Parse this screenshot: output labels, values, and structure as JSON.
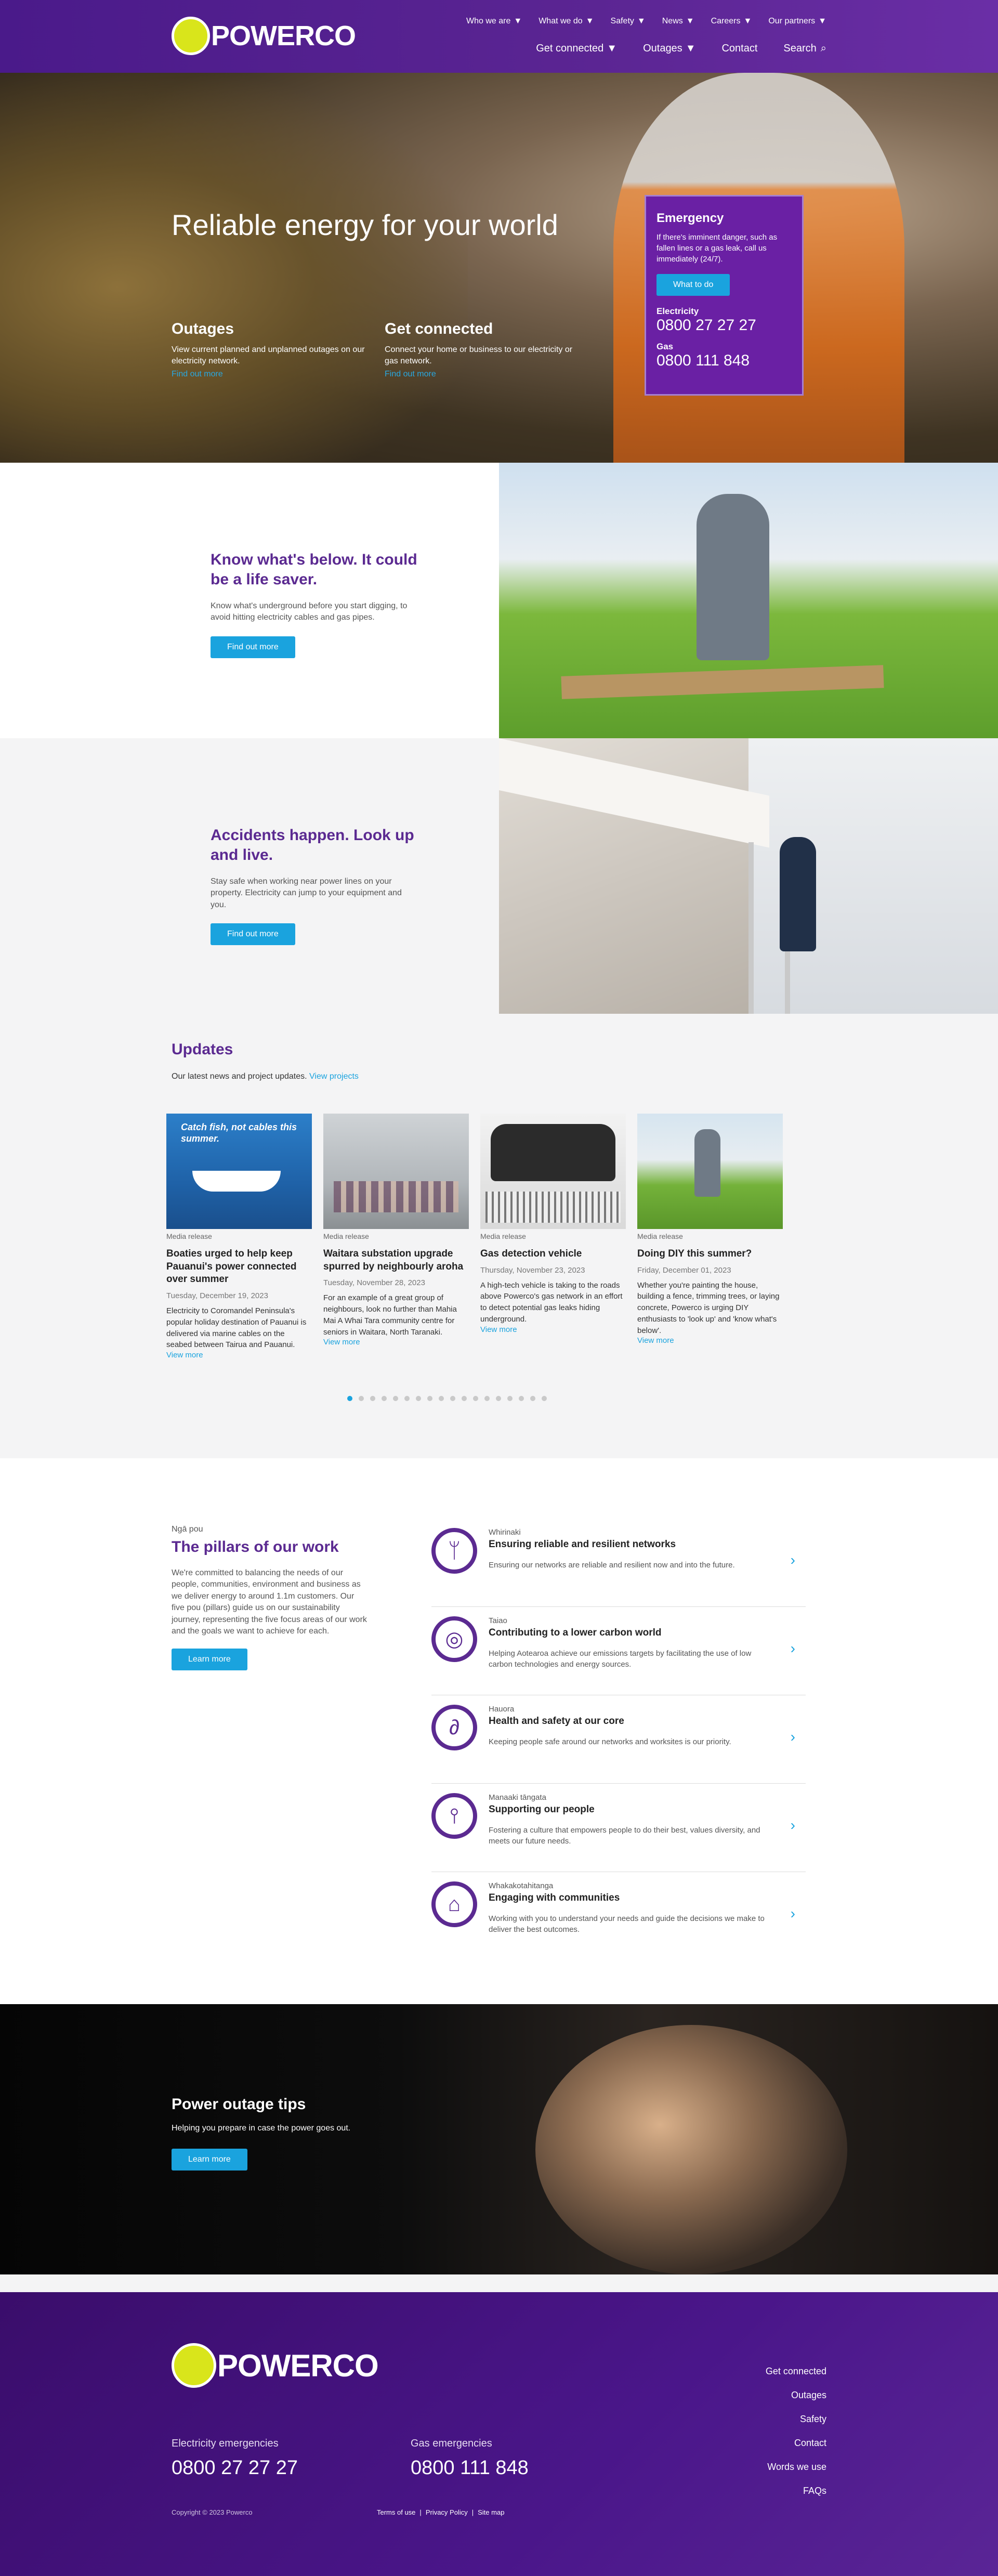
{
  "brand": {
    "name": "POWERCO"
  },
  "nav": {
    "top": [
      "Who we are",
      "What we do",
      "Safety",
      "News",
      "Careers",
      "Our partners"
    ],
    "main": [
      {
        "label": "Get connected",
        "has_menu": true
      },
      {
        "label": "Outages",
        "has_menu": true
      },
      {
        "label": "Contact",
        "has_menu": false
      },
      {
        "label": "Search",
        "has_menu": false
      }
    ]
  },
  "hero": {
    "title": "Reliable energy for your world",
    "outages": {
      "title": "Outages",
      "text": "View current planned and unplanned outages on our electricity network.",
      "link": "Find out more"
    },
    "connected": {
      "title": "Get connected",
      "text": "Connect your home or business to our electricity or gas network.",
      "link": "Find out more"
    },
    "emergency": {
      "title": "Emergency",
      "text": "If there's imminent danger, such as fallen lines or a gas leak, call us immediately (24/7).",
      "button": "What to do",
      "electricity_label": "Electricity",
      "electricity_number": "0800 27 27 27",
      "gas_label": "Gas",
      "gas_number": "0800 111 848"
    }
  },
  "features": [
    {
      "title": "Know what's below. It could be a life saver.",
      "text": "Know what's underground before you start digging, to avoid hitting electricity cables and gas pipes.",
      "button": "Find out more"
    },
    {
      "title": "Accidents happen. Look up and live.",
      "text": "Stay safe when working near power lines on your property. Electricity can jump to your equipment and you.",
      "button": "Find out more"
    }
  ],
  "updates": {
    "title": "Updates",
    "intro": "Our latest news and project updates.",
    "intro_link": "View projects",
    "cards": [
      {
        "category": "Media release",
        "thumb_text": "Catch fish, not cables this summer.",
        "title": "Boaties urged to help keep Pauanui's power connected over summer",
        "date": "Tuesday, December 19, 2023",
        "excerpt": "Electricity to Coromandel Peninsula's popular holiday destination of Pauanui is delivered via marine cables on the seabed between Tairua and Pauanui.",
        "more": "View more"
      },
      {
        "category": "Media release",
        "title": "Waitara substation upgrade spurred by neighbourly aroha",
        "date": "Tuesday, November 28, 2023",
        "excerpt": "For an example of a great group of neighbours, look no further than Mahia Mai A Whai Tara community centre for seniors in Waitara, North Taranaki.",
        "more": "View more"
      },
      {
        "category": "Media release",
        "title": "Gas detection vehicle",
        "date": "Thursday, November 23, 2023",
        "excerpt": "A high-tech vehicle is taking to the roads above Powerco's gas network in an effort to detect potential gas leaks hiding underground.",
        "more": "View more"
      },
      {
        "category": "Media release",
        "title": "Doing DIY this summer?",
        "date": "Friday, December 01, 2023",
        "excerpt": "Whether you're painting the house, building a fence, trimming trees, or laying concrete, Powerco is urging DIY enthusiasts to 'look up' and 'know what's below'.",
        "more": "View more"
      }
    ],
    "dot_count": 18,
    "active_dot": 1
  },
  "pillars": {
    "eyebrow": "Ngā pou",
    "title": "The pillars of our work",
    "description": "We're committed to balancing the needs of our people, communities, environment and business as we deliver energy to around 1.1m customers. Our five pou (pillars) guide us on our sustainability journey, representing the five focus areas of our work and the goals we want to achieve for each.",
    "button": "Learn more",
    "items": [
      {
        "sub": "Whirinaki",
        "title": "Ensuring reliable and resilient networks",
        "text": "Ensuring our networks are reliable and resilient now and into the future.",
        "icon": "network-pillar-icon"
      },
      {
        "sub": "Taiao",
        "title": "Contributing to a lower carbon world",
        "text": "Helping Aotearoa achieve our emissions targets by facilitating the use of low carbon technologies and energy sources.",
        "icon": "carbon-pillar-icon"
      },
      {
        "sub": "Hauora",
        "title": "Health and safety at our core",
        "text": "Keeping people safe around our networks and worksites is our priority.",
        "icon": "safety-pillar-icon"
      },
      {
        "sub": "Manaaki tāngata",
        "title": "Supporting our people",
        "text": "Fostering a culture that empowers people to do their best, values diversity, and meets our future needs.",
        "icon": "people-pillar-icon"
      },
      {
        "sub": "Whakakotahitanga",
        "title": "Engaging with communities",
        "text": "Working with you to understand your needs and guide the decisions we make to deliver the best outcomes.",
        "icon": "community-pillar-icon"
      }
    ]
  },
  "tips": {
    "title": "Power outage tips",
    "text": "Helping you prepare in case the power goes out.",
    "button": "Learn more"
  },
  "footer": {
    "electricity_label": "Electricity emergencies",
    "electricity_number": "0800 27 27 27",
    "gas_label": "Gas emergencies",
    "gas_number": "0800 111 848",
    "links": [
      "Get connected",
      "Outages",
      "Safety",
      "Contact",
      "Words we use",
      "FAQs"
    ],
    "copyright": "Copyright © 2023 Powerco",
    "legal": [
      "Terms of use",
      "Privacy Policy",
      "Site map"
    ]
  },
  "colors": {
    "purple": "#5b2a91",
    "accent_blue": "#1aa3de",
    "logo_yellow": "#d9e51b"
  }
}
